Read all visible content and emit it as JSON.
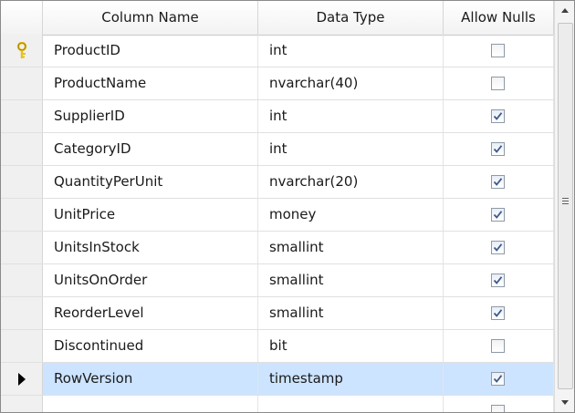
{
  "columns": {
    "name": "Column Name",
    "type": "Data Type",
    "nulls": "Allow Nulls"
  },
  "rows": [
    {
      "name": "ProductID",
      "type": "int",
      "allow_nulls": false,
      "primary_key": true
    },
    {
      "name": "ProductName",
      "type": "nvarchar(40)",
      "allow_nulls": false
    },
    {
      "name": "SupplierID",
      "type": "int",
      "allow_nulls": true
    },
    {
      "name": "CategoryID",
      "type": "int",
      "allow_nulls": true
    },
    {
      "name": "QuantityPerUnit",
      "type": "nvarchar(20)",
      "allow_nulls": true
    },
    {
      "name": "UnitPrice",
      "type": "money",
      "allow_nulls": true
    },
    {
      "name": "UnitsInStock",
      "type": "smallint",
      "allow_nulls": true
    },
    {
      "name": "UnitsOnOrder",
      "type": "smallint",
      "allow_nulls": true
    },
    {
      "name": "ReorderLevel",
      "type": "smallint",
      "allow_nulls": true
    },
    {
      "name": "Discontinued",
      "type": "bit",
      "allow_nulls": false
    },
    {
      "name": "RowVersion",
      "type": "timestamp",
      "allow_nulls": true,
      "selected": true
    },
    {
      "name": "",
      "type": "",
      "allow_nulls": false,
      "new_row": true
    }
  ],
  "colors": {
    "selected_row": "#cce4ff",
    "key_icon": "#e8c020",
    "check": "#3c5a8a"
  },
  "icons": {
    "primary_key": "key-icon",
    "current_row": "row-pointer-icon",
    "scroll_up": "scroll-up-arrow-icon",
    "scroll_down": "scroll-down-arrow-icon",
    "scroll_grip": "scroll-grip-icon"
  }
}
